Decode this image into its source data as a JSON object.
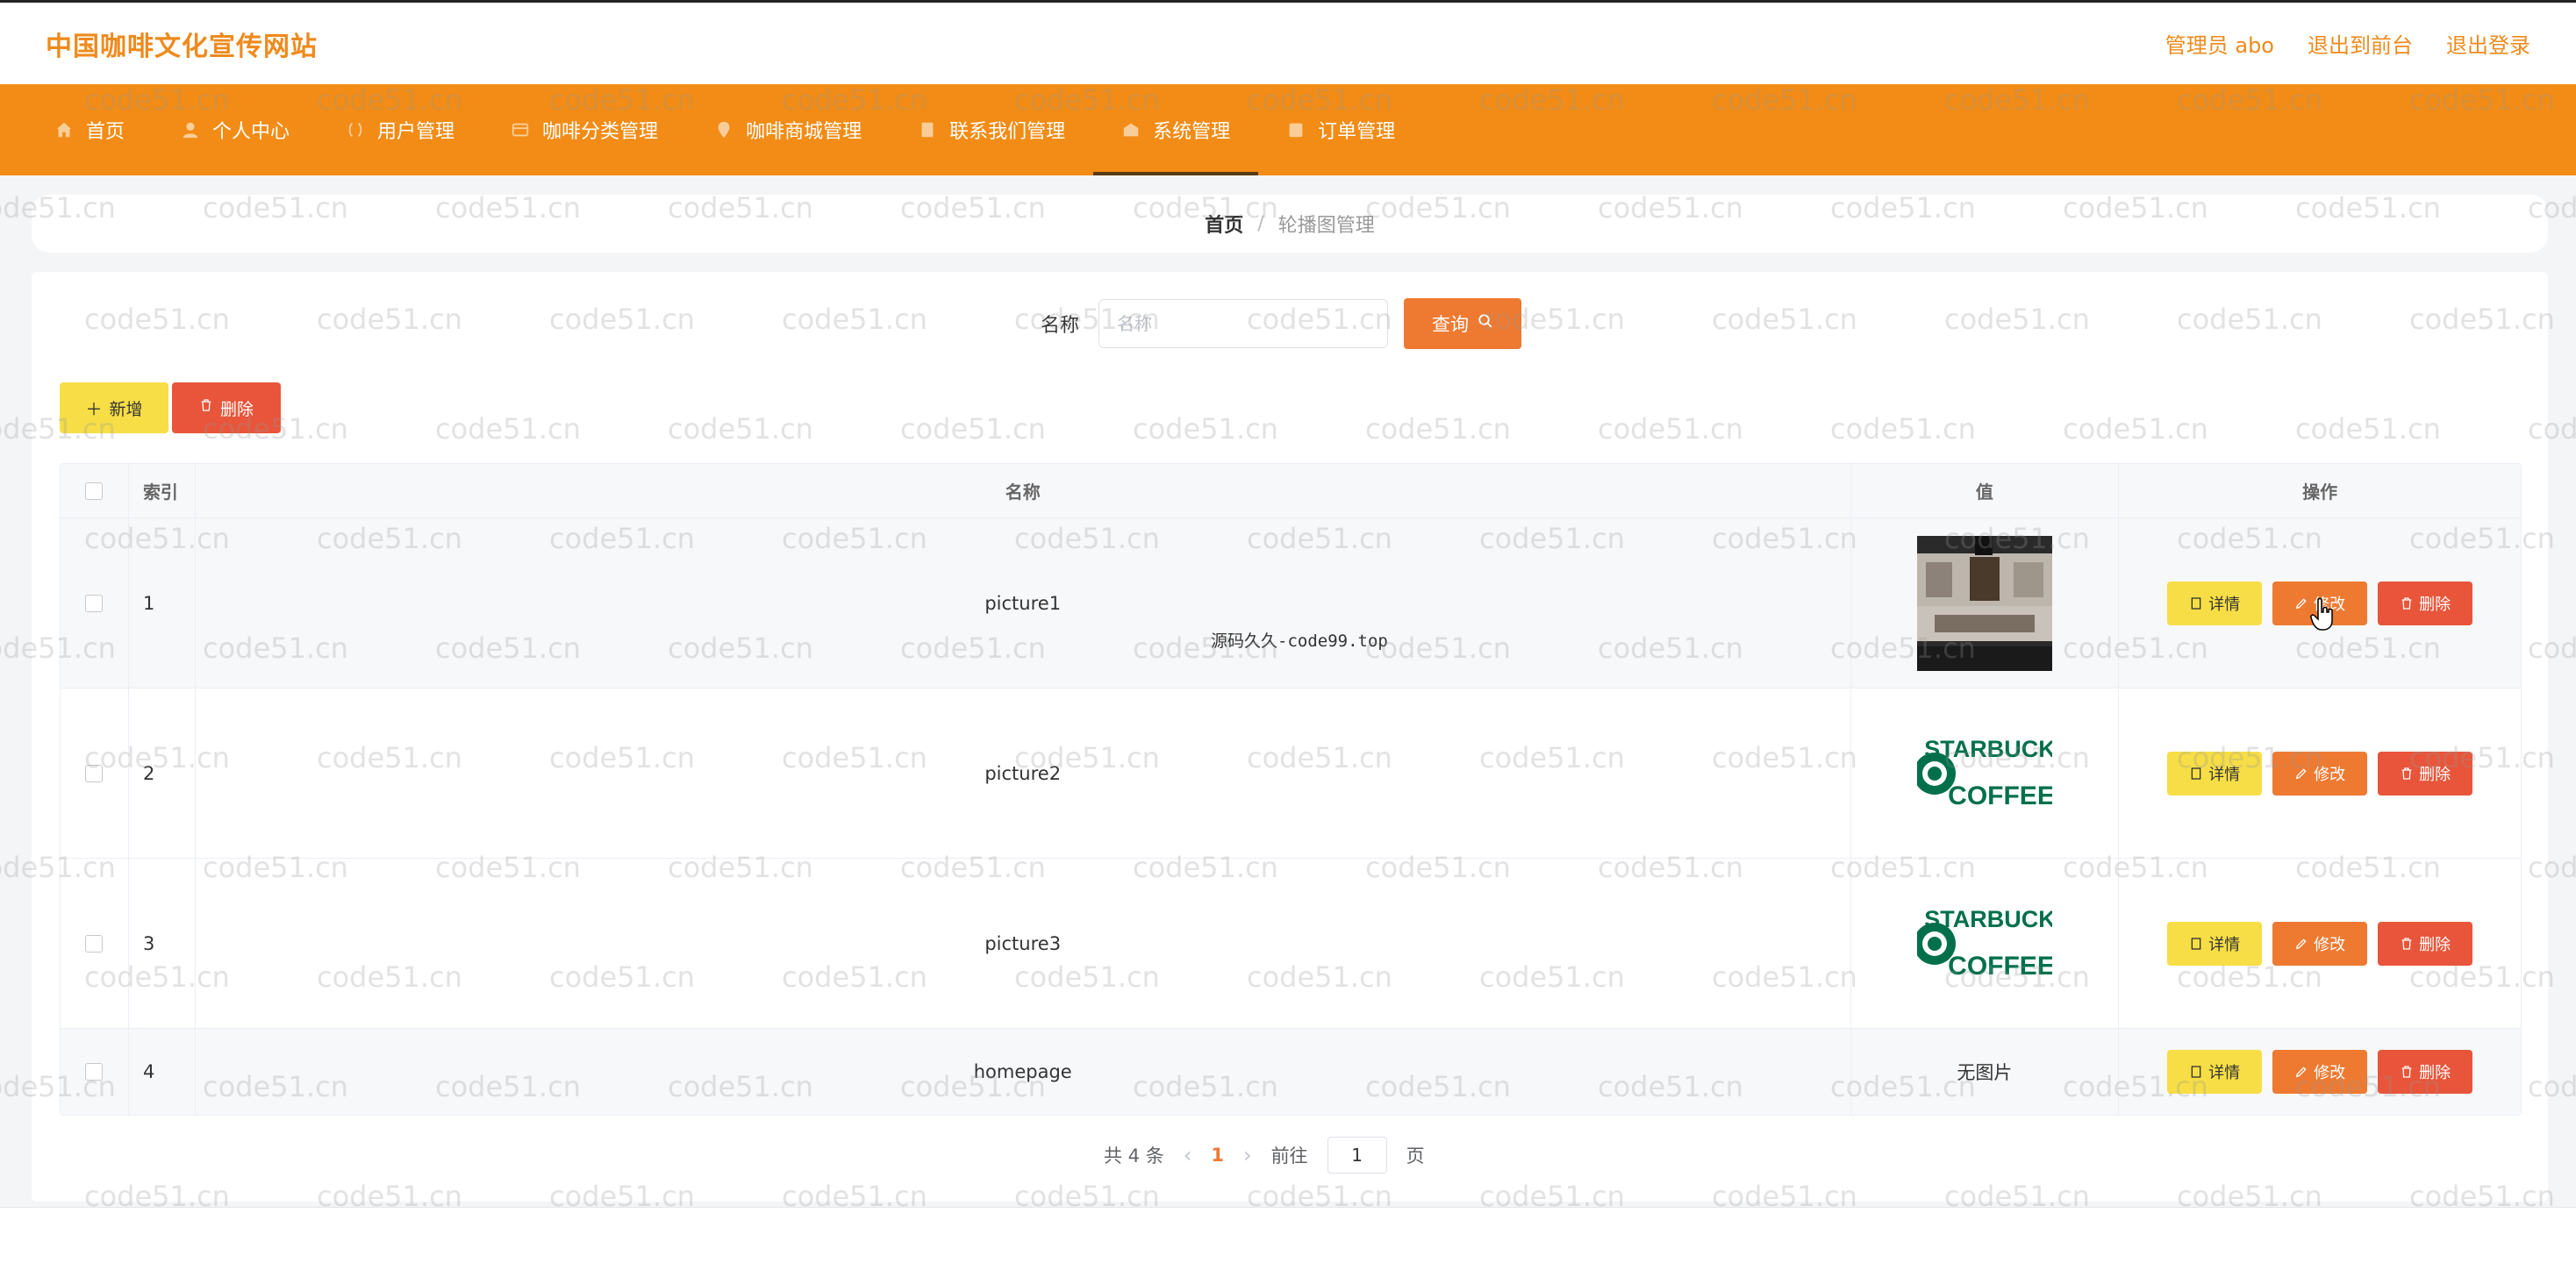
{
  "header": {
    "site_title": "中国咖啡文化宣传网站",
    "admin_label": "管理员 abo",
    "exit_front": "退出到前台",
    "logout": "退出登录"
  },
  "nav": {
    "items": [
      {
        "label": "首页",
        "icon": "home-icon"
      },
      {
        "label": "个人中心",
        "icon": "user-icon"
      },
      {
        "label": "用户管理",
        "icon": "users-icon"
      },
      {
        "label": "咖啡分类管理",
        "icon": "category-icon"
      },
      {
        "label": "咖啡商城管理",
        "icon": "shop-icon"
      },
      {
        "label": "联系我们管理",
        "icon": "contact-icon"
      },
      {
        "label": "系统管理",
        "icon": "system-icon",
        "active": true
      },
      {
        "label": "订单管理",
        "icon": "order-icon"
      }
    ]
  },
  "breadcrumb": {
    "home": "首页",
    "separator": "/",
    "current": "轮播图管理"
  },
  "search": {
    "label": "名称",
    "placeholder": "名称",
    "button_label": "查询"
  },
  "actions": {
    "add_label": "新增",
    "delete_label": "删除"
  },
  "table": {
    "headers": {
      "index": "索引",
      "name": "名称",
      "value": "值",
      "ops": "操作"
    },
    "rows": [
      {
        "index": "1",
        "name": "picture1",
        "value_image": "coffee-shop-photo"
      },
      {
        "index": "2",
        "name": "picture2",
        "value_image": "starbucks-logo"
      },
      {
        "index": "3",
        "name": "picture3",
        "value_image": "starbucks-logo"
      },
      {
        "index": "4",
        "name": "homepage",
        "value_text": "无图片"
      }
    ],
    "op_detail": "详情",
    "op_edit": "修改",
    "op_delete": "删除"
  },
  "pagination": {
    "total": "共 4 条",
    "current_page": "1",
    "goto_prefix": "前往",
    "goto_value": "1",
    "goto_suffix": "页"
  },
  "overlay_text": "源码久久-code99.top",
  "watermark": "code51.cn",
  "colors": {
    "brand_orange": "#f28c16",
    "title_orange": "#ee8a1c",
    "detail_yellow": "#f7de46",
    "edit_orange": "#ee7a32",
    "delete_red": "#e8553a"
  }
}
